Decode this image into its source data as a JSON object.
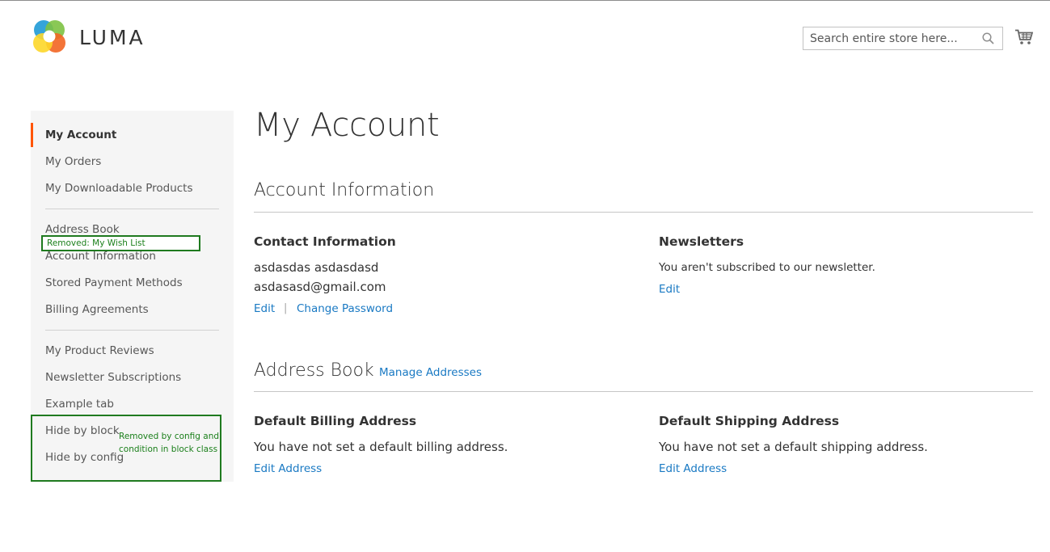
{
  "header": {
    "logo_text": "LUMA",
    "search": {
      "placeholder": "Search entire store here..."
    }
  },
  "sidebar": {
    "items": [
      {
        "label": "My Account",
        "active": true
      },
      {
        "label": "My Orders"
      },
      {
        "label": "My Downloadable Products"
      },
      {
        "label": "Address Book"
      },
      {
        "label": "Account Information"
      },
      {
        "label": "Stored Payment Methods"
      },
      {
        "label": "Billing Agreements"
      },
      {
        "label": "My Product Reviews"
      },
      {
        "label": "Newsletter Subscriptions"
      },
      {
        "label": "Example tab"
      },
      {
        "label": "Hide by block"
      },
      {
        "label": "Hide by config"
      }
    ],
    "annotations": {
      "removed_wishlist": "Removed:  My Wish List",
      "removed_config_line1": "Removed by config and",
      "removed_config_line2": "condition in block class"
    }
  },
  "main": {
    "title": "My Account",
    "account_info": {
      "heading": "Account Information",
      "contact": {
        "title": "Contact Information",
        "name": "asdasdas asdasdasd",
        "email": "asdasasd@gmail.com",
        "edit_label": "Edit",
        "separator": "|",
        "change_password_label": "Change Password"
      },
      "newsletters": {
        "title": "Newsletters",
        "text": "You aren't subscribed to our newsletter.",
        "edit_label": "Edit"
      }
    },
    "address_book": {
      "heading": "Address Book",
      "manage_label": "Manage Addresses",
      "billing": {
        "title": "Default Billing Address",
        "text": "You have not set a default billing address.",
        "edit_label": "Edit Address"
      },
      "shipping": {
        "title": "Default Shipping Address",
        "text": "You have not set a default shipping address.",
        "edit_label": "Edit Address"
      }
    }
  },
  "colors": {
    "link": "#1979c3",
    "active_indicator": "#ff5501",
    "annotation": "#1a7f1a",
    "sidebar_bg": "#f5f5f5"
  }
}
